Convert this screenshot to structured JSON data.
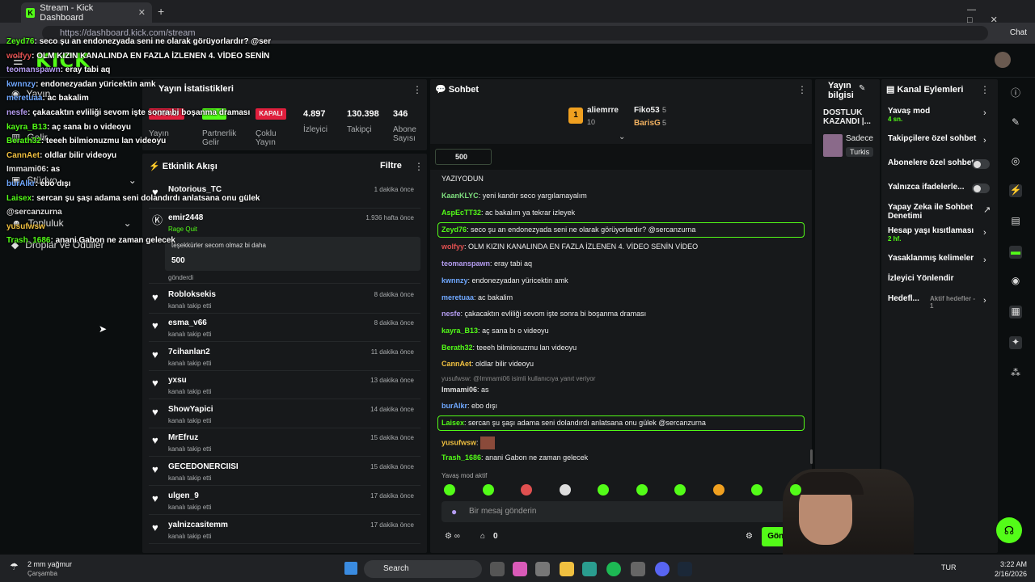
{
  "browser": {
    "tab_title": "Stream - Kick Dashboard",
    "url": "https://dashboard.kick.com/stream",
    "chat_button": "Chat"
  },
  "brand": {
    "logo": "KICK",
    "accent": "#53fc18"
  },
  "nav": {
    "stream": "Yayın",
    "earn": "Gelir",
    "studio": "Stüdyo",
    "community": "Topluluk",
    "drops": "Droplar ve Ödüller"
  },
  "stats": {
    "title": "Yayın İstatistikleri",
    "items": [
      {
        "value": "KAPALI",
        "label": "Yayın"
      },
      {
        "value": "",
        "label": "Partnerlik Gelir"
      },
      {
        "value": "KAPALI",
        "label": "Çoklu Yayın"
      },
      {
        "value": "4.897",
        "label": "İzleyici"
      },
      {
        "value": "130.398",
        "label": "Takipçi"
      },
      {
        "value": "346",
        "label": "Abone Sayısı"
      }
    ]
  },
  "activity": {
    "title": "Etkinlik Akışı",
    "filter": "Filtre",
    "items": [
      {
        "name": "Notorious_TC",
        "sub": "",
        "time": "1 dakika önce"
      },
      {
        "name": "emir2448",
        "sub": "Rage Quit",
        "time": "1.936 hafta önce",
        "msg": "teşekkürler secom olmaz bi daha",
        "kicks": "500",
        "sent": "gönderdi"
      },
      {
        "name": "Robloksekis",
        "sub": "kanalı takip etti",
        "time": "8 dakika önce"
      },
      {
        "name": "esma_v66",
        "sub": "kanalı takip etti",
        "time": "8 dakika önce"
      },
      {
        "name": "7cihanlan2",
        "sub": "kanalı takip etti",
        "time": "11 dakika önce"
      },
      {
        "name": "yxsu",
        "sub": "kanalı takip etti",
        "time": "13 dakika önce"
      },
      {
        "name": "ShowYapici",
        "sub": "kanalı takip etti",
        "time": "14 dakika önce"
      },
      {
        "name": "MrEfruz",
        "sub": "kanalı takip etti",
        "time": "15 dakika önce"
      },
      {
        "name": "GECEDONERCIISI",
        "sub": "kanalı takip etti",
        "time": "15 dakika önce"
      },
      {
        "name": "ulgen_9",
        "sub": "kanalı takip etti",
        "time": "17 dakika önce"
      },
      {
        "name": "yalnizcasitemm",
        "sub": "kanalı takip etti",
        "time": "17 dakika önce"
      }
    ]
  },
  "chat": {
    "title": "Sohbet",
    "top": {
      "first": "aliemrre",
      "first_count": "10",
      "second": "Fiko53",
      "second_count": "5",
      "third": "BarisG",
      "third_count": "5"
    },
    "pinned": "500",
    "partial": "YAZIYODUN",
    "messages": [
      {
        "user": "KaanKLYC",
        "color": "#7fe07f",
        "text": "yeni kandır seco yargılamayalım"
      },
      {
        "user": "AspEcTT32",
        "color": "#53fc18",
        "text": "ac bakalım ya tekrar izleyek"
      },
      {
        "user": "Zeyd76",
        "color": "#53fc18",
        "text": "seco şu an endonezyada seni ne olarak görüyorlardır? @sercanzurna"
      },
      {
        "user": "wolfyy",
        "color": "#e05050",
        "text": "OLM KIZIN KANALINDA EN FAZLA İZLENEN 4. VİDEO SENİN VİDEO"
      },
      {
        "user": "teomanspawn",
        "color": "#b49cf0",
        "text": "eray tabi aq"
      },
      {
        "user": "kwnnzy",
        "color": "#6fa8ff",
        "text": "endonezyadan yüricektin amk"
      },
      {
        "user": "meretuaa",
        "color": "#6fa8ff",
        "text": "ac bakalim"
      },
      {
        "user": "nesfe",
        "color": "#b49cf0",
        "text": "çakacaktın evliliği sevom işte sonra bi boşanma draması"
      },
      {
        "user": "kayra_B13",
        "color": "#53fc18",
        "text": "aç sana bı o videoyu"
      },
      {
        "user": "Berath32",
        "color": "#53fc18",
        "text": "teeeh bilmionuzmu lan videoyu"
      },
      {
        "user": "CannAet",
        "color": "#f0c040",
        "text": "oldlar bilir videoyu"
      },
      {
        "user": "Immami06",
        "color": "#ddd",
        "text": "as",
        "reply": "yusufwsw: @Immami06 isimli kullanıcıya yanıt veriyor"
      },
      {
        "user": "burAlkr",
        "color": "#6fa8ff",
        "text": "ebo dışı"
      },
      {
        "user": "Laisex",
        "color": "#53fc18",
        "text": "sercan şu şaşı adama seni dolandırdı anlatsana onu gülek @sercanzurna"
      },
      {
        "user": "yusufwsw",
        "color": "#f0c040",
        "text": ""
      },
      {
        "user": "Trash_1686",
        "color": "#53fc18",
        "text": "anani Gabon ne zaman gelecek"
      }
    ],
    "slow": "Yavaş mod aktif",
    "placeholder": "Bir mesaj gönderin",
    "points": "0",
    "send": "Gönder"
  },
  "info": {
    "title": "Yayın bilgisi",
    "stream_title": "DOSTLUK KAZANDI |...",
    "category": "Sadece",
    "lang": "Turkis"
  },
  "actions": {
    "title": "Kanal Eylemleri",
    "items": [
      {
        "label": "Yavaş mod",
        "sub": "4 sn."
      },
      {
        "label": "Takipçilere özel sohbet",
        "sub": ""
      },
      {
        "label": "Abonelere özel sohbet",
        "sub": ""
      },
      {
        "label": "Yalnızca ifadelerle...",
        "sub": ""
      },
      {
        "label": "Yapay Zeka ile Sohbet Denetimi",
        "sub": ""
      },
      {
        "label": "Hesap yaşı kısıtlaması",
        "sub": "2 hf."
      },
      {
        "label": "Yasaklanmış kelimeler",
        "sub": ""
      },
      {
        "label": "İzleyici Yönlendir",
        "sub": ""
      },
      {
        "label": "Hedefl...",
        "sub": "Aktif hedefler - 1"
      }
    ]
  },
  "overlay": [
    {
      "u": "Zeyd76",
      "c": "#53fc18",
      "t": "seco şu an endonezyada seni ne olarak görüyorlardır? @ser"
    },
    {
      "u": "wolfyy",
      "c": "#e05050",
      "t": "OLM KIZIN KANALINDA EN FAZLA İZLENEN 4. VİDEO SENİN"
    },
    {
      "u": "teomanspawn",
      "c": "#b49cf0",
      "t": "eray tabi aq"
    },
    {
      "u": "kwnnzy",
      "c": "#6fa8ff",
      "t": "endonezyadan yüricektin amk"
    },
    {
      "u": "meretuaa",
      "c": "#6fa8ff",
      "t": "ac bakalim"
    },
    {
      "u": "nesfe",
      "c": "#b49cf0",
      "t": "çakacaktın evliliği sevom işte sonra bi boşanma draması"
    },
    {
      "u": "kayra_B13",
      "c": "#53fc18",
      "t": "aç sana bı o videoyu"
    },
    {
      "u": "Berath32",
      "c": "#53fc18",
      "t": "teeeh bilmionuzmu lan videoyu"
    },
    {
      "u": "CannAet",
      "c": "#f0c040",
      "t": "oldlar bilir videoyu"
    },
    {
      "u": "Immami06",
      "c": "#ddd",
      "t": "as"
    },
    {
      "u": "burAlkr",
      "c": "#6fa8ff",
      "t": "ebo dışı"
    },
    {
      "u": "Laisex",
      "c": "#53fc18",
      "t": "sercan şu şaşı adama seni dolandırdı anlatsana onu gülek"
    },
    {
      "u": "@sercanzurna",
      "c": "#ddd",
      "t": ""
    },
    {
      "u": "yusufwsw",
      "c": "#f0c040",
      "t": ""
    },
    {
      "u": "Trash_1686",
      "c": "#53fc18",
      "t": "anani Gabon ne zaman gelecek"
    }
  ],
  "taskbar": {
    "weather": "2 mm yağmur",
    "weather_day": "Çarşamba",
    "search": "Search",
    "lang": "TUR",
    "time": "3:22 AM",
    "date": "2/16/2026"
  }
}
